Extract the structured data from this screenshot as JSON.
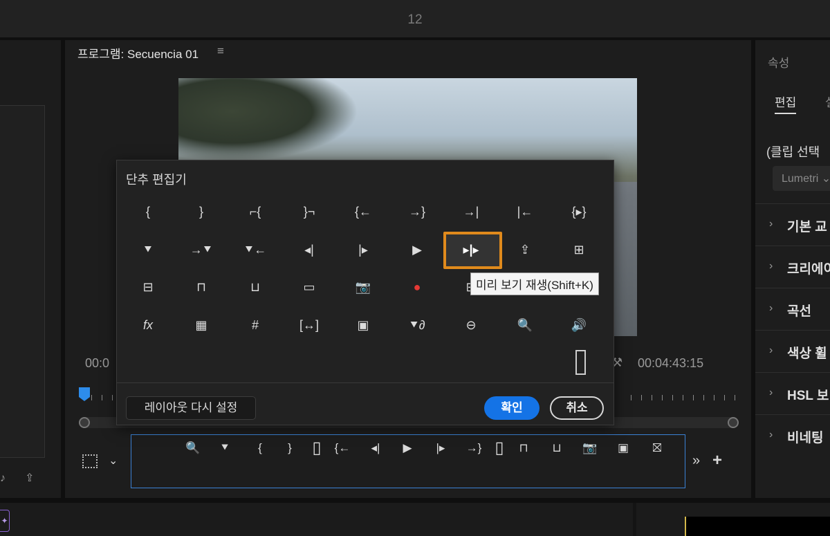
{
  "topbar": {
    "number": "12"
  },
  "program": {
    "title": "프로그램: Secuencia 01",
    "timecode_left": "00:0",
    "timecode_right": "00:04:43:15"
  },
  "dialog": {
    "title": "단추 편집기",
    "tooltip": "미리 보기 재생(Shift+K)",
    "reset_label": "레이아웃 다시 설정",
    "ok_label": "확인",
    "cancel_label": "취소",
    "rows": [
      [
        "mark-in-icon",
        "mark-out-icon",
        "clear-in-icon",
        "clear-out-icon",
        "go-to-in-icon",
        "go-to-out-icon",
        "go-to-next-edit-icon",
        "go-to-prev-edit-icon",
        "play-in-to-out-icon"
      ],
      [
        "add-marker-icon",
        "go-to-next-marker-icon",
        "go-to-prev-marker-icon",
        "step-back-icon",
        "step-forward-icon",
        "play-icon",
        "play-preview-icon",
        "export-icon",
        "overwrite-icon"
      ],
      [
        "extract-icon",
        "lift-icon",
        "insert-icon",
        "safe-margins-icon",
        "camera-icon",
        "record-icon",
        "multicam-icon",
        "vr-icon",
        "proxy-icon"
      ],
      [
        "fx-icon",
        "comparison-icon",
        "snap-icon",
        "trim-icon",
        "multi-frame-icon",
        "marker-link-icon",
        "vr-video-icon",
        "zoom-frame-icon",
        "volume-icon"
      ]
    ],
    "selected_icon": "play-preview-icon"
  },
  "button_bar": {
    "icons": [
      "zoom-frame-icon",
      "add-marker-icon",
      "mark-in-icon",
      "mark-out-icon",
      "spacer-icon",
      "go-to-in-icon",
      "step-back-icon",
      "play-icon",
      "step-forward-icon",
      "go-to-out-icon",
      "spacer-icon",
      "lift-icon",
      "insert-icon",
      "camera-icon",
      "multi-frame-icon",
      "proxy-icon"
    ]
  },
  "right_panel": {
    "title": "속성",
    "tab": "편집",
    "clip_select": "(클립 선택",
    "lumetri": "Lumetri",
    "sections": [
      "기본 교",
      "크리에이",
      "곡선",
      "색상 휠",
      "HSL 보",
      "비네팅"
    ]
  }
}
